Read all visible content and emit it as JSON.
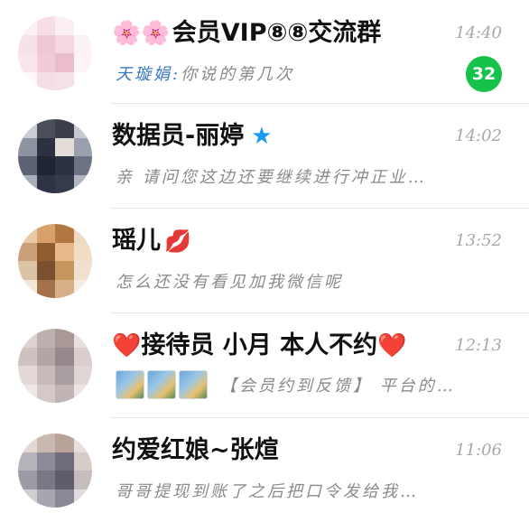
{
  "chats": [
    {
      "prefix": "🌸🌸",
      "name": "会员VIP⑧⑧交流群",
      "time": "14:40",
      "sender": "天璇娟:",
      "preview": "你说的第几次",
      "badge": "32",
      "avatar_colors": [
        "#fbeff2",
        "#f7dde4",
        "#fbeff2",
        "#ffffff",
        "#f6e3e9",
        "#eec8d2",
        "#f4d7df",
        "#fbf2f4",
        "#f9e6ec",
        "#f1ccd7",
        "#ebbcca",
        "#fcf3f6",
        "#fdf7f9",
        "#f6dee5",
        "#f7e1e8",
        "#ffffff"
      ]
    },
    {
      "name": "数据员-丽婷",
      "suffix_icon": "★",
      "time": "14:02",
      "preview": "亲 请问您这边还要继续进行冲正业…",
      "avatar_colors": [
        "#c9ccd4",
        "#4a4f5a",
        "#3a3f4a",
        "#c5c9d1",
        "#8e93a0",
        "#2c3040",
        "#e4dcd6",
        "#9aa0ad",
        "#5d6374",
        "#1f2535",
        "#2b3244",
        "#6d7384",
        "#a9aebb",
        "#2e3446",
        "#353b4d",
        "#b0b5c1"
      ]
    },
    {
      "name": "瑶儿",
      "suffix_icon": "💋",
      "time": "13:52",
      "preview": "怎么还没有看见加我微信呢",
      "avatar_colors": [
        "#e9c9a8",
        "#d8a06a",
        "#b07840",
        "#efd9c3",
        "#caa07a",
        "#8f5c30",
        "#e7b98a",
        "#f1dcc6",
        "#dcc3a5",
        "#7a5030",
        "#c6955e",
        "#efe0d0",
        "#f3e7da",
        "#a3714a",
        "#d7b08a",
        "#f6ece2"
      ]
    },
    {
      "prefix": "❤️",
      "name": "接待员 小月 本人不约",
      "suffix": "❤️",
      "time": "12:13",
      "preview": "【会员约到反馈】 平台的…",
      "avatar_colors": [
        "#dcd2d0",
        "#bfb0b0",
        "#a89896",
        "#e6dfdd",
        "#cfc1c0",
        "#b3a4a6",
        "#96888c",
        "#d9cecd",
        "#e2d9d8",
        "#c7bab9",
        "#a99ea0",
        "#dfd6d5",
        "#ede7e6",
        "#d4c9c8",
        "#c0b4b4",
        "#eae4e3"
      ]
    },
    {
      "name": "约爱红娘~张煊",
      "time": "11:06",
      "preview": "哥哥提现到账了之后把口令发给我…",
      "avatar_colors": [
        "#e3d9d4",
        "#c9b8b0",
        "#b8a29a",
        "#e7dfdb",
        "#b6b3bb",
        "#8e8a97",
        "#6f6b7a",
        "#d6ccc8",
        "#9d9aa6",
        "#7b7886",
        "#5f5c6b",
        "#c5bcbd",
        "#d0cdd3",
        "#a8a5b0",
        "#8a8796",
        "#e1dcdf"
      ]
    }
  ]
}
